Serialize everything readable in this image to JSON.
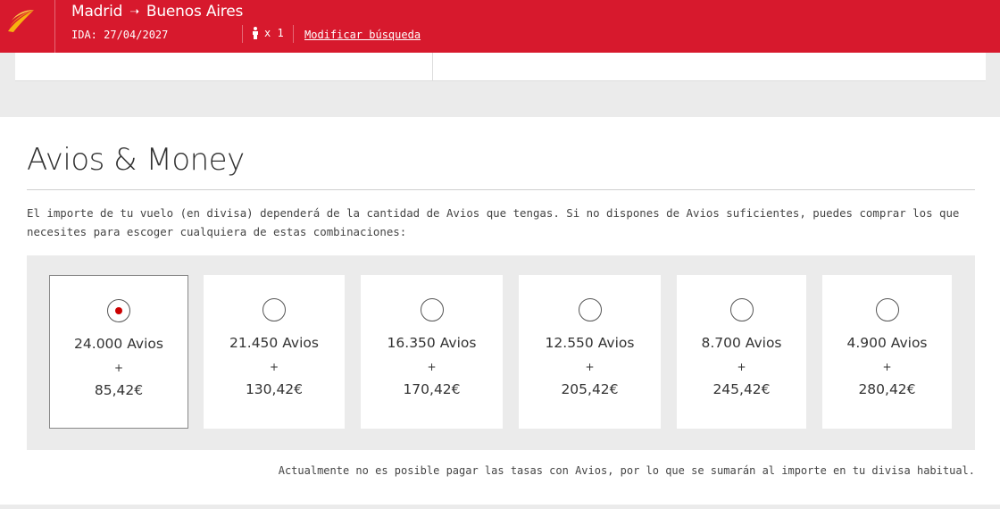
{
  "header": {
    "origin": "Madrid",
    "destination": "Buenos Aires",
    "ida_label": "IDA: 27/04/2027",
    "passengers": "x 1",
    "modify_label": "Modificar búsqueda",
    "brand_color": "#d7192d"
  },
  "section": {
    "title": "Avios & Money",
    "description": "El importe de tu vuelo (en divisa) dependerá de la cantidad de Avios que tengas. Si no dispones de Avios suficientes, puedes comprar los que necesites para escoger cualquiera de estas combinaciones:",
    "footnote": "Actualmente no es posible pagar las tasas con Avios, por lo que se sumarán al importe en tu divisa habitual."
  },
  "options": [
    {
      "avios": "24.000 Avios",
      "plus": "+",
      "money": "85,42€",
      "selected": true
    },
    {
      "avios": "21.450 Avios",
      "plus": "+",
      "money": "130,42€",
      "selected": false
    },
    {
      "avios": "16.350 Avios",
      "plus": "+",
      "money": "170,42€",
      "selected": false
    },
    {
      "avios": "12.550 Avios",
      "plus": "+",
      "money": "205,42€",
      "selected": false
    },
    {
      "avios": "8.700 Avios",
      "plus": "+",
      "money": "245,42€",
      "selected": false
    },
    {
      "avios": "4.900 Avios",
      "plus": "+",
      "money": "280,42€",
      "selected": false
    }
  ]
}
